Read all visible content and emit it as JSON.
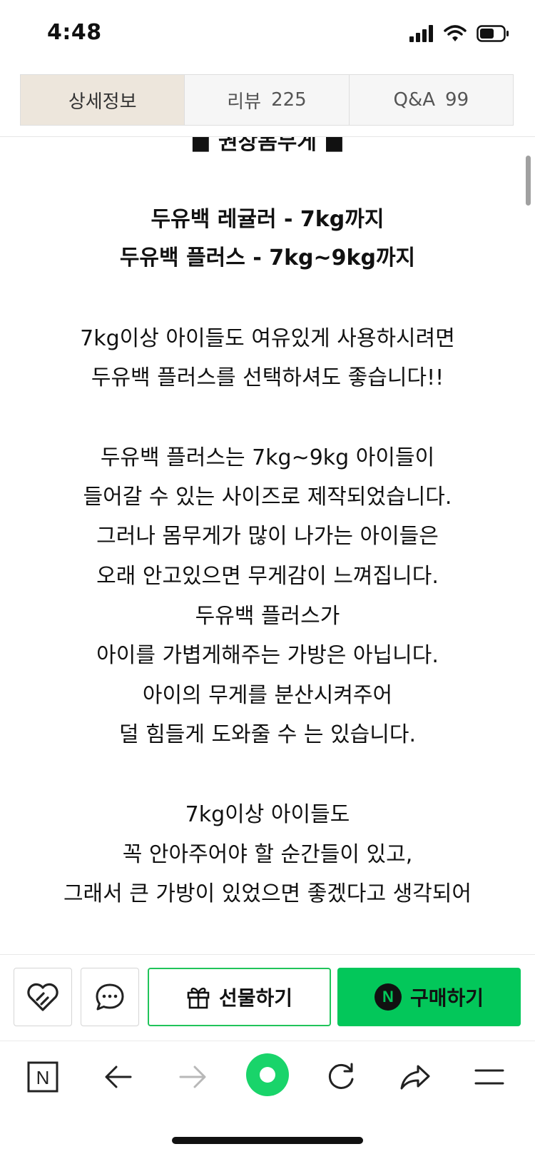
{
  "status_bar": {
    "time": "4:48"
  },
  "tabs": [
    {
      "label": "상세정보",
      "count": ""
    },
    {
      "label": "리뷰",
      "count": "225"
    },
    {
      "label": "Q&A",
      "count": "99"
    }
  ],
  "content": {
    "lines": [
      {
        "text": "■ 권장몸무게 ■",
        "bold": true
      },
      {
        "text": "두유백 레귤러 - 7kg까지",
        "bold": true
      },
      {
        "text": "두유백 플러스 - 7kg~9kg까지",
        "bold": true
      },
      {
        "text": "7kg이상 아이들도 여유있게 사용하시려면",
        "bold": false
      },
      {
        "text": "두유백 플러스를 선택하셔도 좋습니다!!",
        "bold": false
      },
      {
        "text": "두유백 플러스는 7kg~9kg 아이들이",
        "bold": false
      },
      {
        "text": "들어갈 수 있는 사이즈로 제작되었습니다.",
        "bold": false
      },
      {
        "text": "그러나 몸무게가 많이 나가는 아이들은",
        "bold": false
      },
      {
        "text": "오래 안고있으면 무게감이 느껴집니다.",
        "bold": false
      },
      {
        "text": "두유백 플러스가",
        "bold": false
      },
      {
        "text": "아이를 가볍게해주는 가방은 아닙니다.",
        "bold": false
      },
      {
        "text": "아이의 무게를 분산시켜주어",
        "bold": false
      },
      {
        "text": "덜 힘들게 도와줄 수 는 있습니다.",
        "bold": false
      },
      {
        "text": "7kg이상 아이들도",
        "bold": false
      },
      {
        "text": "꼭 안아주어야 할 순간들이 있고,",
        "bold": false
      },
      {
        "text": "그래서 큰 가방이 있었으면 좋겠다고 생각되어",
        "bold": false
      }
    ]
  },
  "actions": {
    "gift_label": "선물하기",
    "buy_label": "구매하기",
    "naver_badge": "N"
  },
  "browser_toolbar": {
    "home_badge": "N"
  },
  "colors": {
    "accent_green": "#03c75a",
    "active_tab_bg": "#ede6dc"
  }
}
